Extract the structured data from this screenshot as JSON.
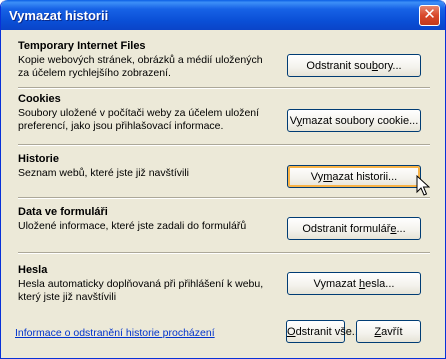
{
  "window": {
    "title": "Vymazat historii"
  },
  "sections": [
    {
      "title": "Temporary Internet Files",
      "description": "Kopie webových stránek, obrázků a médií uložených za účelem rychlejšího zobrazení.",
      "button": {
        "before": "Odstranit sou",
        "key": "b",
        "after": "ory..."
      }
    },
    {
      "title": "Cookies",
      "description": "Soubory uložené v počítači weby za účelem uložení preferencí, jako jsou přihlašovací informace.",
      "button": {
        "before": "V",
        "key": "y",
        "after": "mazat soubory cookie..."
      }
    },
    {
      "title": "Historie",
      "description": "Seznam webů, které jste již navštívili",
      "button": {
        "before": "Vy",
        "key": "m",
        "after": "azat historii..."
      }
    },
    {
      "title": "Data ve formuláři",
      "description": "Uložené informace, které jste zadali do formulářů",
      "button": {
        "before": "Odstranit formulář",
        "key": "e",
        "after": "..."
      }
    },
    {
      "title": "Hesla",
      "description": "Hesla automaticky doplňovaná při přihlášení k webu, který jste již navštívili",
      "button": {
        "before": "Vymazat ",
        "key": "h",
        "after": "esla..."
      }
    }
  ],
  "footer": {
    "link": "Informace o odstranění historie procházení",
    "delete_all": {
      "before": "",
      "key": "O",
      "after": "dstranit vše..."
    },
    "close": {
      "before": "",
      "key": "Z",
      "after": "avřít"
    }
  }
}
